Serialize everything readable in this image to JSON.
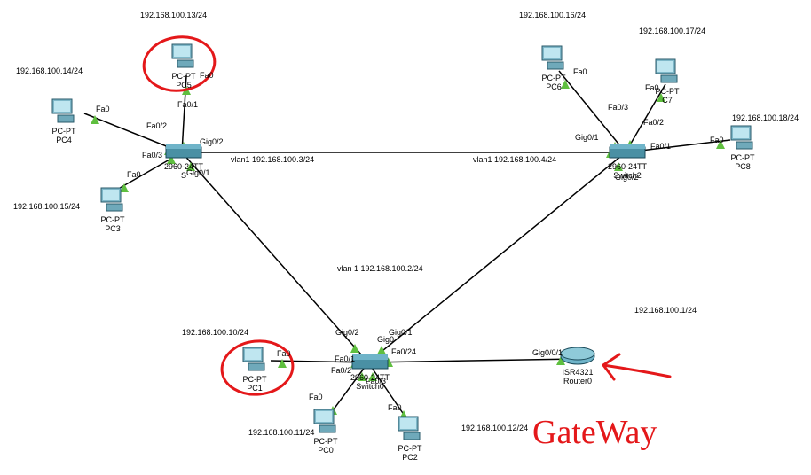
{
  "devices": {
    "pc5": {
      "name": "PC-PT",
      "host": "PC5",
      "ip": "192.168.100.13/24",
      "port": "Fa0"
    },
    "pc4": {
      "name": "PC-PT",
      "host": "PC4",
      "ip": "192.168.100.14/24",
      "port": "Fa0"
    },
    "pc3": {
      "name": "PC-PT",
      "host": "PC3",
      "ip": "192.168.100.15/24",
      "port": "Fa0"
    },
    "pc6": {
      "name": "PC-PT",
      "host": "PC6",
      "ip": "192.168.100.16/24",
      "port": "Fa0"
    },
    "pc7": {
      "name": "PC-PT",
      "host": "C7",
      "ip": "192.168.100.17/24",
      "port": "Fa0"
    },
    "pc8": {
      "name": "PC-PT",
      "host": "PC8",
      "ip": "192.168.100.18/24",
      "port": "Fa0"
    },
    "pc1": {
      "name": "PC-PT",
      "host": "PC1",
      "ip": "192.168.100.10/24",
      "port": "Fa0"
    },
    "pc0": {
      "name": "PC-PT",
      "host": "PC0",
      "ip": "192.168.100.11/24",
      "port": "Fa0"
    },
    "pc2": {
      "name": "PC-PT",
      "host": "PC2",
      "ip": "192.168.100.12/24",
      "port": "Fa0"
    },
    "sS": {
      "name": "2960-24TT",
      "host": "S"
    },
    "s2": {
      "name": "2960-24TT",
      "host": "Switch2"
    },
    "s0": {
      "name": "2960-24TT",
      "host": "Switch0"
    },
    "r0": {
      "name": "ISR4321",
      "host": "Router0",
      "ip": "192.168.100.1/24"
    }
  },
  "ports": {
    "sS": {
      "fa01": "Fa0/1",
      "fa02": "Fa0/2",
      "fa03": "Fa0/3",
      "g01": "Gig0/1",
      "g02": "Gig0/2"
    },
    "s2": {
      "fa01": "Fa0/1",
      "fa02": "Fa0/2",
      "fa03": "Fa0/3",
      "g01": "Gig0/1",
      "g02": "Gig0/2"
    },
    "s0": {
      "fa01": "Fa0/1",
      "fa02": "Fa0/2",
      "fa03": "Fa0/3",
      "fa024": "Fa0/24",
      "g0": "Gig0",
      "g01": "Gig0/1",
      "g02": "Gig0/2"
    },
    "r0": {
      "g000": "Gig0/0/1"
    }
  },
  "vlans": {
    "s_vlan": "vlan1 192.168.100.3/24",
    "s2_vlan": "vlan1 192.168.100.4/24",
    "s0_vlan": "vlan 1 192.168.100.2/24"
  },
  "annotation": "GateWay"
}
